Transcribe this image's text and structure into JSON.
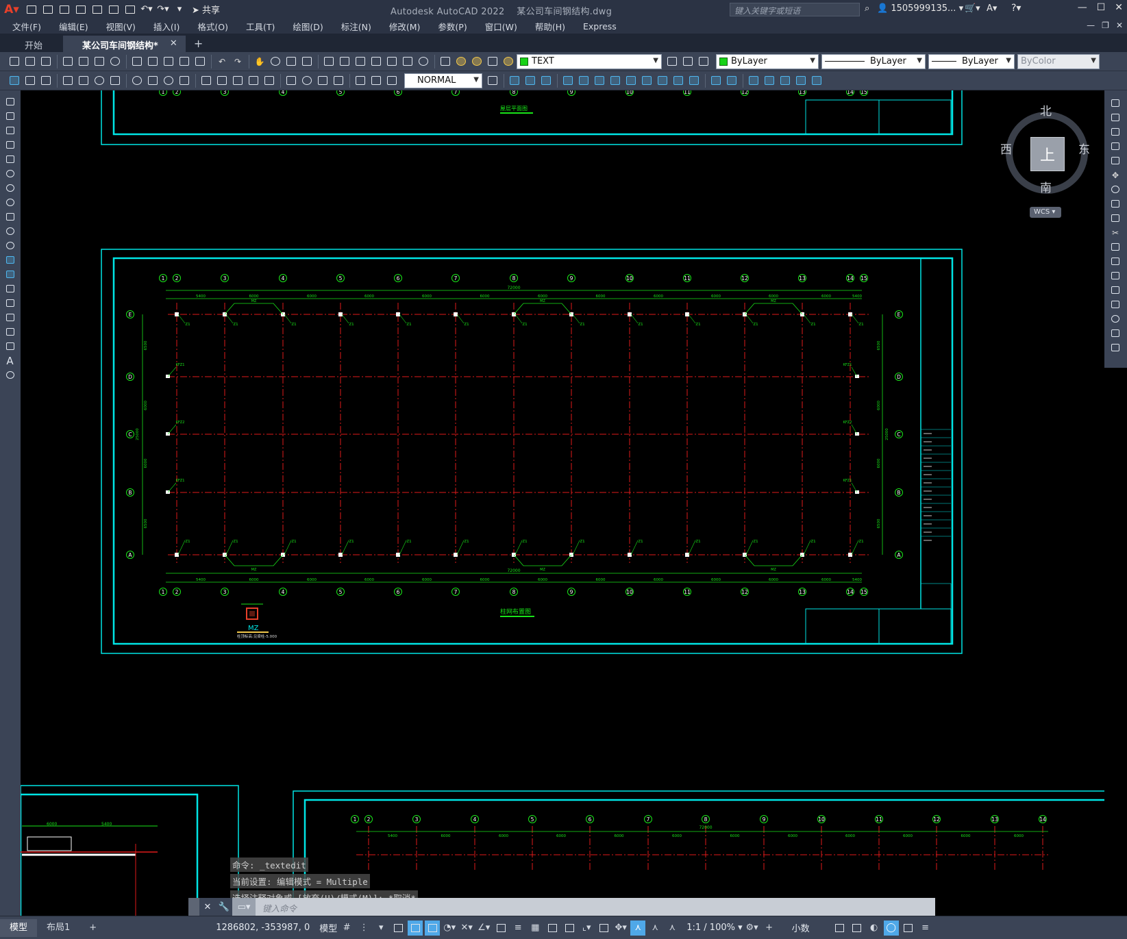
{
  "app": {
    "title": "Autodesk AutoCAD 2022",
    "filename": "某公司车间钢结构.dwg",
    "share_label": "共享",
    "search_placeholder": "键入关键字或短语",
    "user": "1505999135... ▾",
    "accent": "#e8402a"
  },
  "menu": {
    "items": [
      "文件(F)",
      "编辑(E)",
      "视图(V)",
      "插入(I)",
      "格式(O)",
      "工具(T)",
      "绘图(D)",
      "标注(N)",
      "修改(M)",
      "参数(P)",
      "窗口(W)",
      "帮助(H)",
      "Express"
    ]
  },
  "doc_tabs": {
    "start": "开始",
    "active": "某公司车间钢结构*",
    "close": "✕",
    "add": "+"
  },
  "toolbar": {
    "layer_name": "TEXT",
    "color": "ByLayer",
    "linetype": "ByLayer",
    "lineweight": "ByLayer",
    "plotstyle": "ByColor",
    "dimstyle": "NORMAL"
  },
  "viewcube": {
    "top": "上",
    "north": "北",
    "south": "南",
    "west": "西",
    "east": "东",
    "wcs": "WCS ▾"
  },
  "drawing": {
    "colors": {
      "frame": "#00e5e5",
      "axis": "#e01a1a",
      "dim": "#19e619",
      "column": "#ffffff",
      "text": "#19e619"
    },
    "top_title": "屋层平面图",
    "plan_title": "柱网布置图",
    "detail_label": "MZ",
    "detail_note": "柱顶标高:见梁柱-5.000",
    "axis_numbers": [
      "1",
      "2",
      "3",
      "4",
      "5",
      "6",
      "7",
      "8",
      "9",
      "10",
      "11",
      "12",
      "13",
      "14",
      "15"
    ],
    "axis_letters": [
      "E",
      "D",
      "C",
      "B",
      "A"
    ],
    "bay_dims": [
      "5400",
      "6000",
      "6000",
      "6000",
      "6000",
      "6000",
      "6000",
      "6000",
      "6000",
      "6000",
      "6000",
      "6000",
      "5400"
    ],
    "total_length": "72000",
    "span_dims": [
      "6500",
      "6000",
      "6000",
      "6500"
    ],
    "total_span": "25000",
    "col_labels": [
      "Z1",
      "KFZ1",
      "KFZ2",
      "MZ"
    ],
    "bottom_dims": [
      "6000",
      "5400"
    ]
  },
  "command": {
    "history": [
      "命令: _textedit",
      "当前设置: 编辑模式 = Multiple",
      "选择注释对象或 [放弃(U)/模式(M)]: *取消*"
    ],
    "placeholder": "键入命令"
  },
  "status": {
    "tabs": [
      "模型",
      "布局1",
      "+"
    ],
    "coords": "1286802, -353987, 0",
    "mode": "模型",
    "scale": "1:1 / 100% ▾",
    "units": "小数"
  }
}
